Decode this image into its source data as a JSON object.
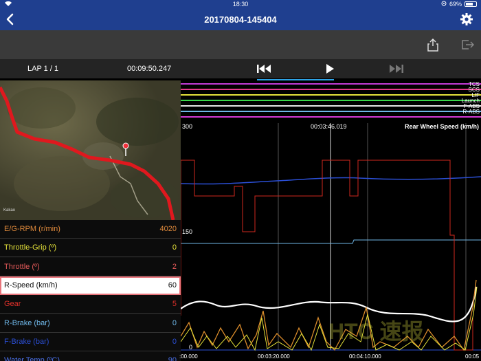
{
  "status_bar": {
    "time": "18:30",
    "battery_pct": "69%",
    "battery_level": 0.69
  },
  "header": {
    "title": "20170804-145404",
    "back_icon": "chevron-left-icon",
    "settings_icon": "gear-icon"
  },
  "toolbar": {
    "share_icon": "share-icon",
    "export_icon": "export-icon"
  },
  "controls": {
    "lap": "LAP 1 / 1",
    "elapsed": "00:09:50.247",
    "rewind_icon": "rewind-icon",
    "play_icon": "play-icon",
    "fast_forward_icon": "fast-forward-icon"
  },
  "map": {
    "watermark": "Kakao"
  },
  "channels": [
    {
      "label": "E/G-RPM (r/min)",
      "value": "4020",
      "color": "#e08a3c",
      "selected": false
    },
    {
      "label": "Throttle-Grip (º)",
      "value": "0",
      "color": "#e6e33a",
      "selected": false
    },
    {
      "label": "Throttle (º)",
      "value": "2",
      "color": "#e55a5a",
      "selected": false
    },
    {
      "label": "R-Speed (km/h)",
      "value": "60",
      "color": "#111111",
      "selected": true
    },
    {
      "label": "Gear",
      "value": "5",
      "color": "#e0302a",
      "selected": false
    },
    {
      "label": "R-Brake (bar)",
      "value": "0",
      "color": "#6fb7e8",
      "selected": false
    },
    {
      "label": "F-Brake (bar)",
      "value": "0",
      "color": "#2b4fd6",
      "selected": false
    },
    {
      "label": "Water Temp (ºC)",
      "value": "90",
      "color": "#4a6fe6",
      "selected": false
    }
  ],
  "chart": {
    "flags": [
      {
        "name": "TCS",
        "color": "#c23bd6"
      },
      {
        "name": "SCS",
        "color": "#e63a8e"
      },
      {
        "name": "LIF",
        "color": "#e6e33a"
      },
      {
        "name": "Launch",
        "color": "#3ad64a"
      },
      {
        "name": "F-ABS",
        "color": "#e6e6e6"
      },
      {
        "name": "R-ABS",
        "color": "#6fb7e8"
      },
      {
        "name": "",
        "color": "#d63ad6"
      }
    ],
    "y_max_label": "300",
    "y_mid_label": "150",
    "y_min_label": "0",
    "cursor_time": "00:03:46.019",
    "series_title": "Rear Wheel Speed (km/h)",
    "x_ticks": [
      ":00.000",
      "00:03:20.000",
      "00:04:10.000",
      "00:05"
    ],
    "watermark": "HTC 速报"
  }
}
